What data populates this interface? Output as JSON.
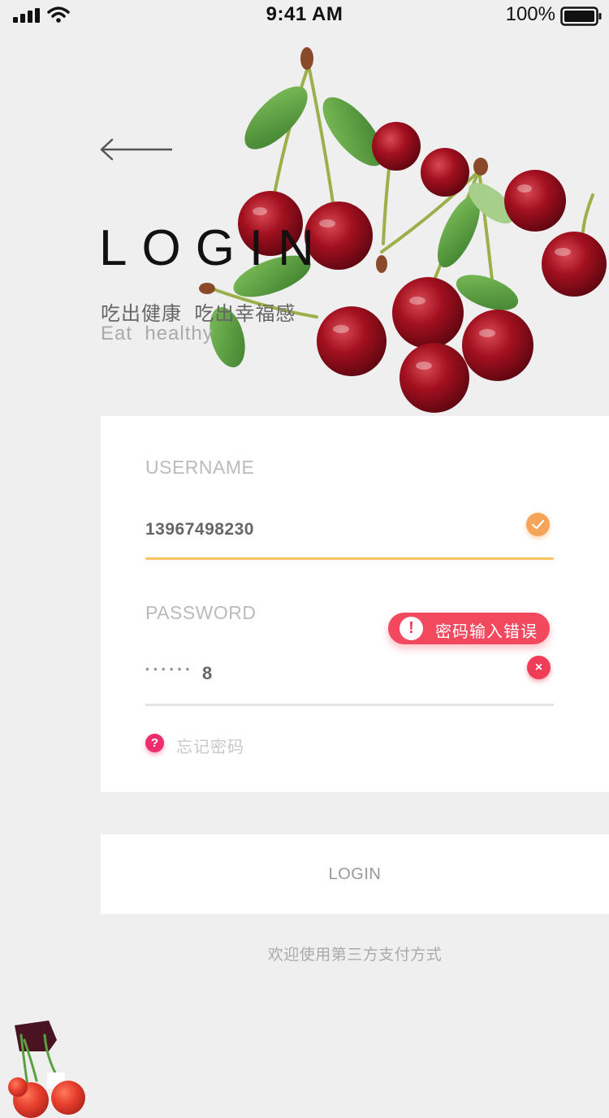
{
  "status_bar": {
    "time": "9:41 AM",
    "battery_percent": "100%",
    "icons": [
      "signal-icon",
      "wifi-icon",
      "battery-icon"
    ]
  },
  "header": {
    "back_icon": "arrow-left-icon",
    "title": "LOGIN",
    "slogan_cn": "吃出健康  吃出幸福感",
    "slogan_en": "Eat  healthy"
  },
  "form": {
    "username": {
      "label": "USERNAME",
      "value": "13967498230",
      "status_icon": "check-icon"
    },
    "password": {
      "label": "PASSWORD",
      "masked": "••••••",
      "last_char": "8",
      "status_icon": "clear-icon",
      "error_icon": "!",
      "error_message": "密码输入错误"
    },
    "forgot": {
      "icon": "?",
      "label": "忘记密码"
    }
  },
  "login_button": {
    "label": "LOGIN"
  },
  "footer": {
    "third_party_text": "欢迎使用第三方支付方式"
  },
  "colors": {
    "background": "#efefef",
    "accent_yellow": "#f8c35e",
    "check_orange": "#f6a45a",
    "error_red": "#f2495f",
    "help_pink": "#ee2d6c"
  }
}
